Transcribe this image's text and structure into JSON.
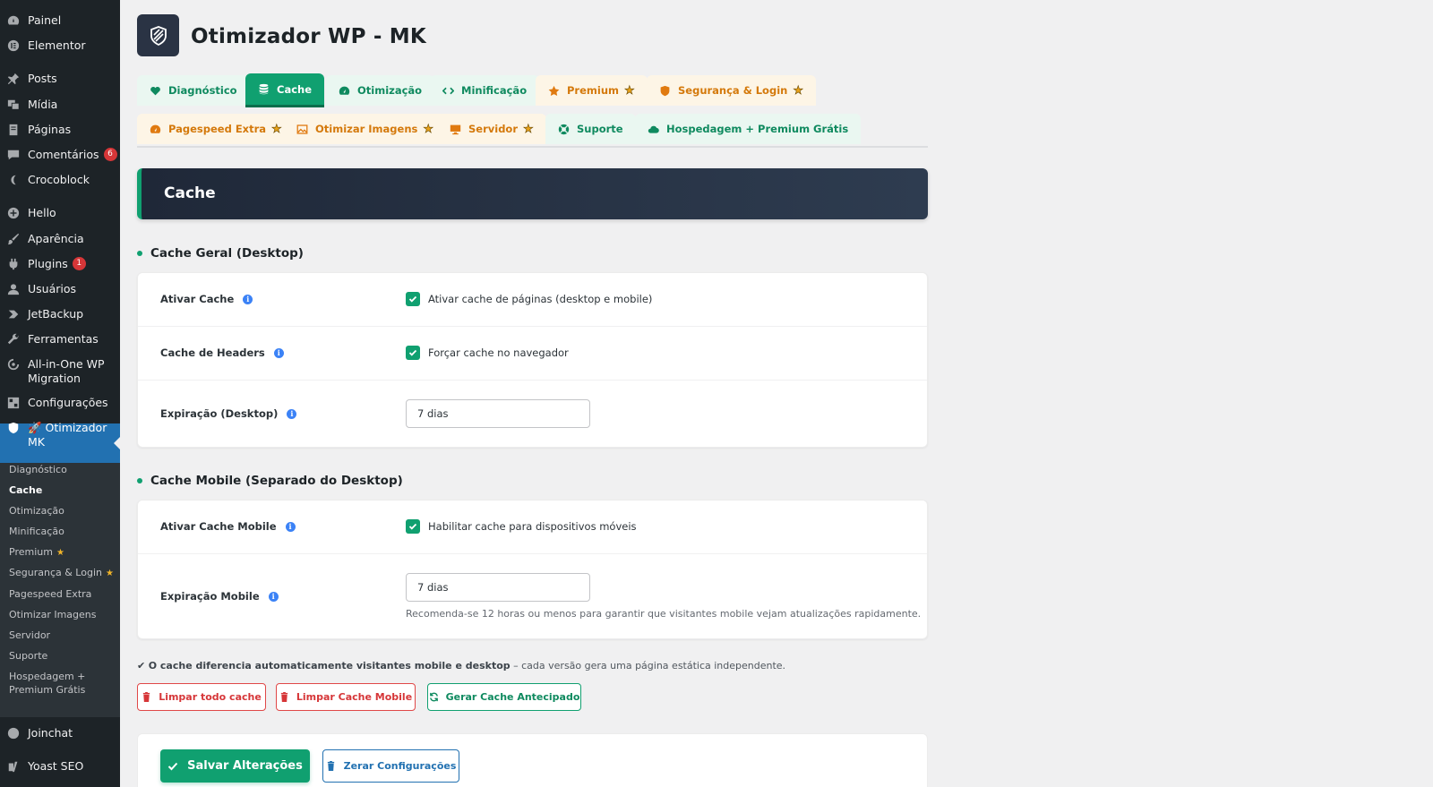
{
  "sidebar": {
    "items": [
      {
        "label": "Painel",
        "icon": "dashboard-icon"
      },
      {
        "label": "Elementor",
        "icon": "elementor-icon"
      },
      {
        "label": "Posts",
        "icon": "pin-icon"
      },
      {
        "label": "Mídia",
        "icon": "media-icon"
      },
      {
        "label": "Páginas",
        "icon": "pages-icon"
      },
      {
        "label": "Comentários",
        "icon": "comments-icon",
        "badge": "6"
      },
      {
        "label": "Crocoblock",
        "icon": "crocoblock-icon"
      },
      {
        "label": "Hello",
        "icon": "plus-circle-icon"
      },
      {
        "label": "Aparência",
        "icon": "brush-icon"
      },
      {
        "label": "Plugins",
        "icon": "plugins-icon",
        "badge": "1"
      },
      {
        "label": "Usuários",
        "icon": "users-icon"
      },
      {
        "label": "JetBackup",
        "icon": "jetbackup-icon"
      },
      {
        "label": "Ferramentas",
        "icon": "wrench-icon"
      },
      {
        "label": "All-in-One WP Migration",
        "icon": "migration-icon"
      },
      {
        "label": "Configurações",
        "icon": "settings-icon"
      },
      {
        "label": "🚀 Otimizador MK",
        "icon": "shield-icon"
      },
      {
        "label": "Joinchat",
        "icon": "chat-icon"
      },
      {
        "label": "Yoast SEO",
        "icon": "yoast-icon"
      }
    ],
    "submenu": [
      {
        "label": "Diagnóstico"
      },
      {
        "label": "Cache"
      },
      {
        "label": "Otimização"
      },
      {
        "label": "Minificação"
      },
      {
        "label": "Premium",
        "star": "★"
      },
      {
        "label": "Segurança & Login",
        "star": "★"
      },
      {
        "label": "Pagespeed Extra"
      },
      {
        "label": "Otimizar Imagens"
      },
      {
        "label": "Servidor"
      },
      {
        "label": "Suporte"
      },
      {
        "label": "Hospedagem + Premium Grátis"
      }
    ]
  },
  "header": {
    "title": "Otimizador WP - MK"
  },
  "tabs": [
    {
      "label": "Diagnóstico",
      "icon": "heart-icon"
    },
    {
      "label": "Cache",
      "icon": "database-icon"
    },
    {
      "label": "Otimização",
      "icon": "gauge-icon"
    },
    {
      "label": "Minificação",
      "icon": "code-icon"
    },
    {
      "label": "Premium",
      "icon": "star-icon",
      "star": "★"
    },
    {
      "label": "Segurança & Login",
      "icon": "shield-icon",
      "star": "★"
    },
    {
      "label": "Pagespeed Extra",
      "icon": "speed-icon",
      "star": "★"
    },
    {
      "label": "Otimizar Imagens",
      "icon": "image-icon",
      "star": "★"
    },
    {
      "label": "Servidor",
      "icon": "monitor-icon",
      "star": "★"
    },
    {
      "label": "Suporte",
      "icon": "lifebuoy-icon"
    },
    {
      "label": "Hospedagem + Premium Grátis",
      "icon": "cloud-icon"
    }
  ],
  "section": {
    "title": "Cache"
  },
  "desktop": {
    "title": "Cache Geral (Desktop)",
    "rows": [
      {
        "label": "Ativar Cache",
        "checkbox_label": "Ativar cache de páginas (desktop e mobile)",
        "checked": true
      },
      {
        "label": "Cache de Headers",
        "checkbox_label": "Forçar cache no navegador",
        "checked": true
      },
      {
        "label": "Expiração (Desktop)",
        "value": "7 dias"
      }
    ]
  },
  "mobile": {
    "title": "Cache Mobile (Separado do Desktop)",
    "rows": [
      {
        "label": "Ativar Cache Mobile",
        "checkbox_label": "Habilitar cache para dispositivos móveis",
        "checked": true
      },
      {
        "label": "Expiração Mobile",
        "value": "7 dias",
        "hint": "Recomenda-se 12 horas ou menos para garantir que visitantes mobile vejam atualizações rapidamente."
      }
    ]
  },
  "note": {
    "check": "✔",
    "bold": "O cache diferencia automaticamente visitantes mobile e desktop",
    "rest": " – cada versão gera uma página estática independente."
  },
  "actions": {
    "clear_all": "Limpar todo cache",
    "clear_mobile": "Limpar Cache Mobile",
    "preload": "Gerar Cache Antecipado"
  },
  "footer": {
    "save": "Salvar Alterações",
    "reset": "Zerar Configurações"
  },
  "colors": {
    "accent": "#10a070",
    "sidebar": "#1d2327",
    "active_menu": "#2271b1",
    "danger": "#d63638",
    "premium": "#d4790b"
  }
}
